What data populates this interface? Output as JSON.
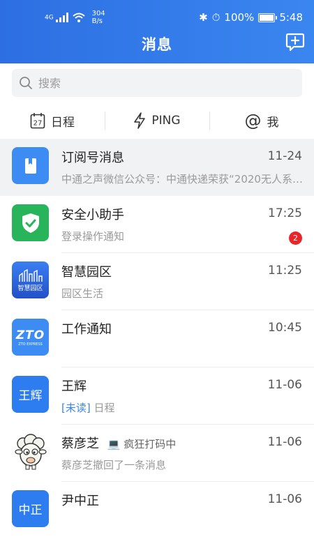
{
  "status_bar": {
    "signal_label": "4G",
    "speed_value": "304",
    "speed_unit": "B/s",
    "battery": "100%",
    "time": "5:48"
  },
  "header": {
    "title": "消息"
  },
  "search": {
    "placeholder": "搜索"
  },
  "quick_actions": [
    {
      "icon": "calendar-icon",
      "icon_text": "27",
      "label": "日程"
    },
    {
      "icon": "lightning-icon",
      "label": "PING"
    },
    {
      "icon": "at-icon",
      "icon_text": "@",
      "label": "我"
    }
  ],
  "messages": [
    {
      "name": "订阅号消息",
      "time": "11-24",
      "preview": "中通之声微信公众号：中通快递荣获“2020无人系…",
      "avatar": "bookmark-icon",
      "color": "#3d8cf4"
    },
    {
      "name": "安全小助手",
      "time": "17:25",
      "preview": "登录操作通知",
      "badge": "2",
      "avatar": "shield-check-icon",
      "color": "#28b45a"
    },
    {
      "name": "智慧园区",
      "time": "11:25",
      "preview": "园区生活",
      "avatar_text": "智慧园区",
      "avatar": "building-icon",
      "color": "#2d6fe3"
    },
    {
      "name": "工作通知",
      "time": "10:45",
      "preview": "",
      "avatar_text": "ZTO",
      "avatar_sub": "ZTO EXPRESS",
      "avatar": "zto-logo",
      "color": "#3d8cf4"
    },
    {
      "name": "王辉",
      "time": "11-06",
      "unread": "[未读]",
      "preview": "日程",
      "avatar_text": "王辉",
      "avatar": "initials-avatar",
      "color": "#2d7cf0"
    },
    {
      "name": "蔡彦芝",
      "status": "疯狂打码中",
      "time": "11-06",
      "preview": "蔡彦芝撤回了一条消息",
      "avatar": "sheep-avatar"
    },
    {
      "name": "尹中正",
      "time": "11-06",
      "avatar_text": "中正",
      "avatar": "initials-avatar",
      "color": "#2d7cf0"
    }
  ],
  "colors": {
    "header_start": "#2d6fe3",
    "header_end": "#3a86f0",
    "badge": "#e8262a",
    "unread_tag": "#3a86f0"
  }
}
